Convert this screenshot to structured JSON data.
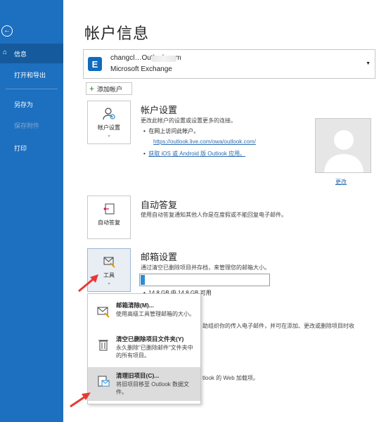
{
  "sidebar": {
    "back_icon": "back-arrow-icon",
    "items": [
      {
        "label": "信息",
        "icon": "home-icon"
      },
      {
        "label": "打开和导出"
      },
      {
        "label": "另存为"
      },
      {
        "label": "保存附件"
      },
      {
        "label": "打印"
      }
    ]
  },
  "main": {
    "title": "帐户信息",
    "account": {
      "email": "changcl…Outlook.com",
      "type": "Microsoft Exchange"
    },
    "add_account_label": "添加帐户",
    "account_settings": {
      "tile_label": "帐户设置",
      "title": "帐户设置",
      "desc": "更改此帐户的设置或设置更多的连接。",
      "bullets": [
        "在网上访问此帐户。",
        "https://outlook.live.com/owa/outlook.com/",
        "获取 iOS 或 Android 版 Outlook 应用。"
      ]
    },
    "avatar_change_label": "更改",
    "auto_reply": {
      "tile_label": "自动答复",
      "title": "自动答复",
      "desc": "使用自动答复通知其他人你是在度假或不能回复电子邮件。"
    },
    "mailbox": {
      "tile_label": "工具",
      "title": "邮箱设置",
      "desc": "通过清空已删除项目并存档，来管理您的邮箱大小。",
      "quota_text": "14.8 GB 中 14.8 GB 可用",
      "quota_fraction": 0.03
    },
    "behind_text_1": "助组织你的传入电子邮件，并可在添加、更改或删除项目时收",
    "behind_text_2": "tlook 的 Web 加载项。"
  },
  "tools_menu": {
    "items": [
      {
        "title": "邮箱清除(M)...",
        "desc": "使用高级工具管理邮箱的大小。",
        "icon": "mailbox-cleanup-icon"
      },
      {
        "title": "清空已删除项目文件夹(Y)",
        "desc": "永久删除\"已删除邮件\"文件夹中的所有项目。",
        "icon": "trash-icon"
      },
      {
        "title": "清理旧项目(C)...",
        "desc": "将旧项目移至 Outlook 数据文件。",
        "icon": "archive-icon"
      }
    ]
  },
  "colors": {
    "sidebar": "#1d6fbf",
    "accent": "#2d8ed1",
    "annotation_arrow": "#e53935"
  }
}
